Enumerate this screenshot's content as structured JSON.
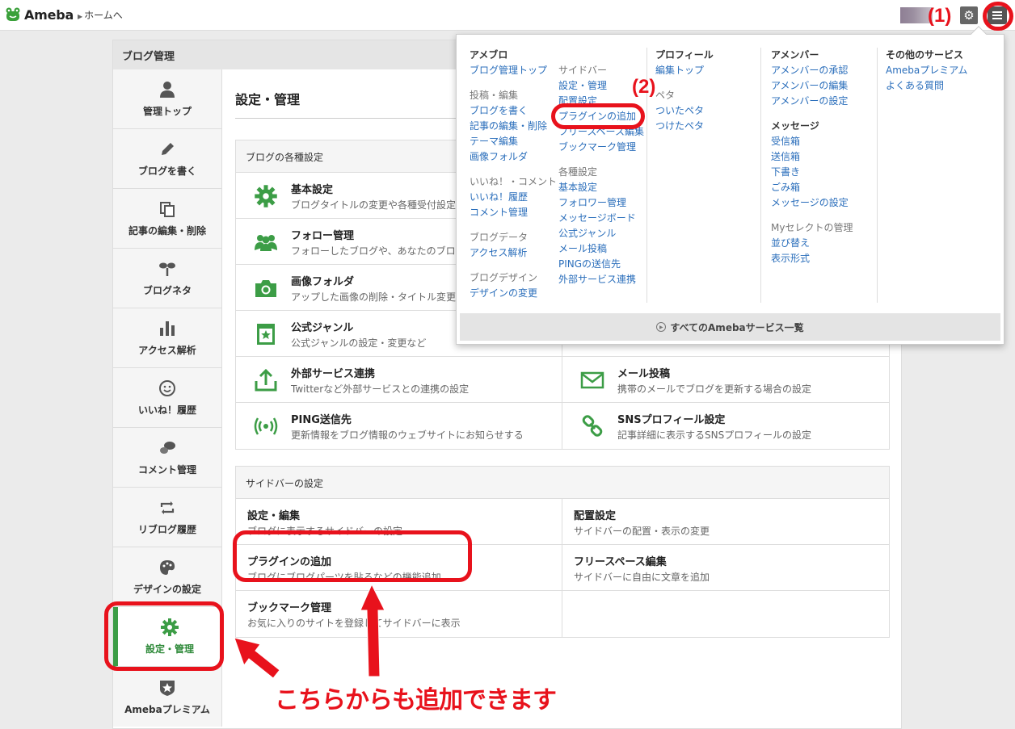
{
  "topbar": {
    "logo_text": "Ameba",
    "home_link": "ホームへ"
  },
  "container": {
    "title": "ブログ管理"
  },
  "sidenav": [
    {
      "label": "管理トップ",
      "icon": "person-icon"
    },
    {
      "label": "ブログを書く",
      "icon": "pencil-icon"
    },
    {
      "label": "記事の編集・削除",
      "icon": "documents-icon"
    },
    {
      "label": "ブログネタ",
      "icon": "sprout-icon"
    },
    {
      "label": "アクセス解析",
      "icon": "bar-chart-icon"
    },
    {
      "label": "いいね！履歴",
      "icon": "smile-icon"
    },
    {
      "label": "コメント管理",
      "icon": "speech-bubbles-icon"
    },
    {
      "label": "リブログ履歴",
      "icon": "reblog-icon"
    },
    {
      "label": "デザインの設定",
      "icon": "palette-icon"
    },
    {
      "label": "設定・管理",
      "icon": "gear-icon",
      "active": true
    },
    {
      "label": "Amebaプレミアム",
      "icon": "shield-star-icon"
    }
  ],
  "main": {
    "page_title": "設定・管理",
    "blog_settings": {
      "header": "ブログの各種設定",
      "items": [
        {
          "title": "基本設定",
          "desc": "ブログタイトルの変更や各種受付設定",
          "icon": "gear-icon"
        },
        {
          "title": "",
          "desc": "",
          "icon": ""
        },
        {
          "title": "フォロー管理",
          "desc": "フォローしたブログや、あなたのブロ",
          "icon": "people-icon"
        },
        {
          "title": "",
          "desc": "",
          "icon": ""
        },
        {
          "title": "画像フォルダ",
          "desc": "アップした画像の削除・タイトル変更",
          "icon": "camera-icon"
        },
        {
          "title": "",
          "desc": "",
          "icon": ""
        },
        {
          "title": "公式ジャンル",
          "desc": "公式ジャンルの設定・変更など",
          "icon": "star-page-icon"
        },
        {
          "title": "",
          "desc": "",
          "icon": ""
        },
        {
          "title": "外部サービス連携",
          "desc": "Twitterなど外部サービスとの連携の設定",
          "icon": "upload-icon"
        },
        {
          "title": "メール投稿",
          "desc": "携帯のメールでブログを更新する場合の設定",
          "icon": "mail-icon"
        },
        {
          "title": "PING送信先",
          "desc": "更新情報をブログ情報のウェブサイトにお知らせする",
          "icon": "broadcast-icon"
        },
        {
          "title": "SNSプロフィール設定",
          "desc": "記事詳細に表示するSNSプロフィールの設定",
          "icon": "chain-link-icon"
        }
      ]
    },
    "sidebar_settings": {
      "header": "サイドバーの設定",
      "items": [
        {
          "title": "設定・編集",
          "desc": "ブログに表示するサイドバーの設定"
        },
        {
          "title": "配置設定",
          "desc": "サイドバーの配置・表示の変更"
        },
        {
          "title": "プラグインの追加",
          "desc": "ブログにブログパーツを貼るなどの機能追加"
        },
        {
          "title": "フリースペース編集",
          "desc": "サイドバーに自由に文章を追加"
        },
        {
          "title": "ブックマーク管理",
          "desc": "お気に入りのサイトを登録してサイドバーに表示"
        },
        {
          "title": "",
          "desc": ""
        }
      ]
    }
  },
  "dropdown": {
    "col1": {
      "header": "アメブロ",
      "links1": [
        "ブログ管理トップ"
      ],
      "sub1": "投稿・編集",
      "links2": [
        "ブログを書く",
        "記事の編集・削除",
        "テーマ編集",
        "画像フォルダ"
      ],
      "sub2": "いいね！・コメント",
      "links3": [
        "いいね！履歴",
        "コメント管理"
      ],
      "sub3": "ブログデータ",
      "links4": [
        "アクセス解析"
      ],
      "sub4": "ブログデザイン",
      "links5": [
        "デザインの変更"
      ]
    },
    "col2": {
      "sub1": "サイドバー",
      "links1": [
        "設定・管理",
        "配置設定",
        "プラグインの追加",
        "フリースペース編集",
        "ブックマーク管理"
      ],
      "sub2": "各種設定",
      "links2": [
        "基本設定",
        "フォロワー管理",
        "メッセージボード",
        "公式ジャンル",
        "メール投稿",
        "PINGの送信先",
        "外部サービス連携"
      ]
    },
    "col3": {
      "header": "プロフィール",
      "links1": [
        "編集トップ"
      ],
      "sub1": "ペタ",
      "links2": [
        "ついたペタ",
        "つけたペタ"
      ]
    },
    "col4": {
      "header": "アメンバー",
      "links1": [
        "アメンバーの承認",
        "アメンバーの編集",
        "アメンバーの設定"
      ],
      "header2": "メッセージ",
      "links2": [
        "受信箱",
        "送信箱",
        "下書き",
        "ごみ箱",
        "メッセージの設定"
      ],
      "sub1": "Myセレクトの管理",
      "links3": [
        "並び替え",
        "表示形式"
      ]
    },
    "col5": {
      "header": "その他のサービス",
      "links1": [
        "Amebaプレミアム",
        "よくある質問"
      ]
    },
    "footer": "すべてのAmebaサービス一覧"
  },
  "annotations": {
    "label1": "(1)",
    "label2": "(2)",
    "callout": "こちらからも追加できます",
    "color": "#e8121c"
  },
  "colors": {
    "accent_green": "#3c9d46",
    "link_blue": "#2a6ebb"
  }
}
